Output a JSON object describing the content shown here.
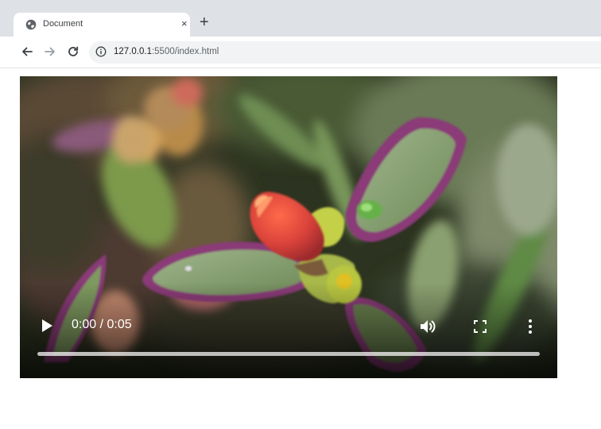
{
  "browser": {
    "tab": {
      "title": "Document",
      "favicon": "globe-icon",
      "close_label": "×"
    },
    "new_tab_label": "+",
    "nav": {
      "back_icon": "arrow-left-icon",
      "forward_icon": "arrow-right-icon",
      "reload_icon": "reload-icon"
    },
    "address": {
      "security_icon": "info-icon",
      "host": "127.0.0.1",
      "path": ":5500/index.html"
    }
  },
  "video": {
    "current_time": "0:00",
    "duration": "0:05",
    "time_display": "0:00 / 0:05",
    "progress": 0,
    "controls": {
      "play_icon": "play-icon",
      "volume_icon": "volume-icon",
      "fullscreen_icon": "fullscreen-icon",
      "menu_icon": "more-vertical-icon"
    }
  },
  "colors": {
    "tabstrip": "#dee1e6",
    "omnibox": "#f1f3f4",
    "flower_red": "#d8413a",
    "leaf_purple": "#8a3a78",
    "leaf_green": "#7f9a58"
  }
}
